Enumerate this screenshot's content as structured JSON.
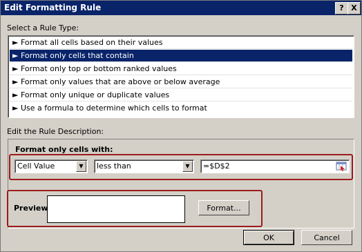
{
  "window": {
    "title": "Edit Formatting Rule",
    "help_glyph": "?",
    "close_glyph": "X"
  },
  "rule_type": {
    "label": "Select a Rule Type:",
    "items": [
      {
        "label": "► Format all cells based on their values",
        "selected": false
      },
      {
        "label": "► Format only cells that contain",
        "selected": true
      },
      {
        "label": "► Format only top or bottom ranked values",
        "selected": false
      },
      {
        "label": "► Format only values that are above or below average",
        "selected": false
      },
      {
        "label": "► Format only unique or duplicate values",
        "selected": false
      },
      {
        "label": "► Use a formula to determine which cells to format",
        "selected": false
      }
    ]
  },
  "description": {
    "label": "Edit the Rule Description:",
    "header": "Format only cells with:",
    "condition_field": "Cell Value",
    "operator": "less than",
    "value": "=$D$2"
  },
  "preview": {
    "label": "Preview:",
    "format_button": "Format..."
  },
  "buttons": {
    "ok": "OK",
    "cancel": "Cancel"
  },
  "colors": {
    "title_bar": "#0a246a",
    "selection": "#0a246a",
    "highlight_border": "#9b1c1c",
    "dialog_bg": "#d4d0c8"
  },
  "icons": {
    "dropdown": "dropdown-arrow-icon",
    "range_picker": "range-picker-icon"
  }
}
